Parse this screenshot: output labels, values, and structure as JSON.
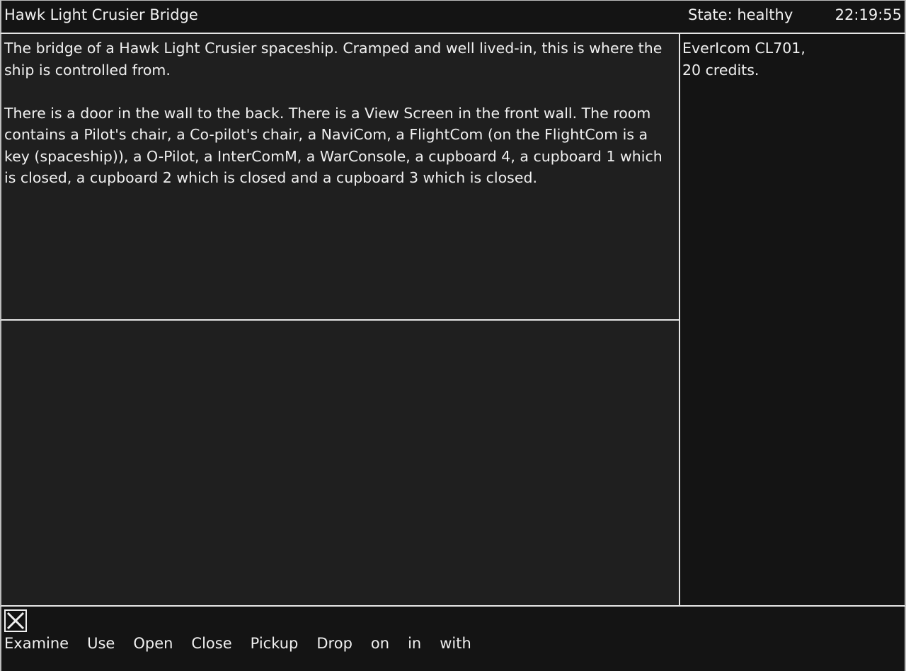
{
  "header": {
    "room_title": "Hawk Light Crusier Bridge",
    "state": "State: healthy",
    "clock": "22:19:55"
  },
  "description": {
    "paragraphs": [
      "The bridge of a Hawk Light Crusier spaceship. Cramped and well lived-in, this is where the ship is controlled from.",
      "There is a door in the wall to the back. There is a View Screen in the front wall. The room contains a Pilot's chair, a Co-pilot's chair, a NaviCom, a FlightCom (on the FlightCom is a key (spaceship)), a O-Pilot, a InterComM, a WarConsole, a cupboard 4, a cupboard 1 which is closed, a cupboard 2 which is closed and a cupboard 3 which is closed."
    ]
  },
  "output": {
    "text": ""
  },
  "inventory": {
    "lines": [
      "EverIcom CL701,",
      "20 credits."
    ]
  },
  "command_bar": {
    "clear_icon": "close-x-icon",
    "verbs": [
      "Examine",
      "Use",
      "Open",
      "Close",
      "Pickup",
      "Drop",
      "on",
      "in",
      "with"
    ]
  },
  "colors": {
    "background": "#141414",
    "panel": "#1f1f1f",
    "text": "#f0f0f0",
    "border": "#e6e6e6"
  }
}
